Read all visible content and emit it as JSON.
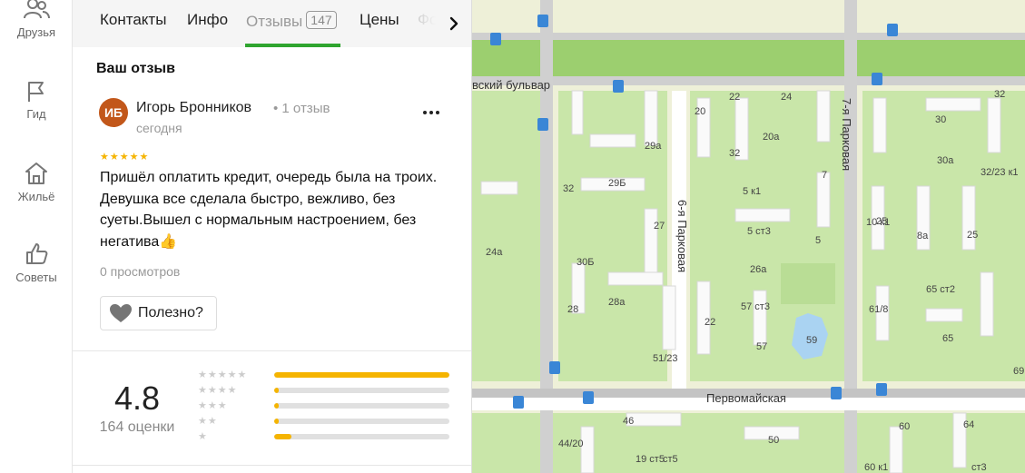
{
  "sidebar": {
    "items": [
      {
        "label": "Друзья",
        "icon": "friends-icon"
      },
      {
        "label": "Гид",
        "icon": "flag-icon"
      },
      {
        "label": "Жильё",
        "icon": "house-icon"
      },
      {
        "label": "Советы",
        "icon": "thumbs-up-icon"
      }
    ]
  },
  "tabs": [
    {
      "label": "Контакты"
    },
    {
      "label": "Инфо"
    },
    {
      "label": "Отзывы",
      "count": "147",
      "active": true
    },
    {
      "label": "Цены"
    },
    {
      "label": "Фо"
    }
  ],
  "review": {
    "section_title": "Ваш отзыв",
    "avatar_initials": "ИБ",
    "author": "Игорь Бронников",
    "author_meta": "• 1 отзыв",
    "date": "сегодня",
    "stars": "★★★★★",
    "text": "Пришёл оплатить кредит, очередь была на троих. Девушка все сделала быстро, вежливо, без суеты.Вышел с нормальным настроением, без негатива👍",
    "views": "0 просмотров",
    "helpful_label": "Полезно?"
  },
  "rating": {
    "score": "4.8",
    "count_label": "164 оценки",
    "distribution": [
      {
        "stars": "★★★★★",
        "fraction": 1.0
      },
      {
        "stars": "★★★★",
        "fraction": 0.02
      },
      {
        "stars": "★★★",
        "fraction": 0.02
      },
      {
        "stars": "★★",
        "fraction": 0.02
      },
      {
        "stars": "★",
        "fraction": 0.1
      }
    ]
  },
  "map": {
    "streets": {
      "boulevard": "вский бульвар",
      "parkovaya7": "7-я Парковая",
      "parkovaya6": "6-я Парковая",
      "pervomayskaya": "Первомайская"
    },
    "house_numbers": [
      "22",
      "24",
      "32",
      "20",
      "30",
      "32",
      "20а",
      "29а",
      "30а",
      "32/23 к1",
      "29Б",
      "32",
      "5 к1",
      "7",
      "25",
      "10 к1",
      "8а",
      "25",
      "27",
      "5 ст3",
      "5",
      "24а",
      "30Б",
      "26а",
      "65 ст2",
      "28а",
      "28",
      "57 ст3",
      "61/8",
      "22",
      "59",
      "65",
      "51/23",
      "57",
      "69",
      "46",
      "64",
      "60",
      "44/20",
      "50",
      "19 ст5",
      "60 к1",
      "ст3",
      "ст5"
    ],
    "colors": {
      "water": "#aad3f2",
      "green": "#c9e6a9",
      "land": "#eef0d8",
      "road": "#ffffff",
      "rail": "#b9b9b9"
    }
  }
}
